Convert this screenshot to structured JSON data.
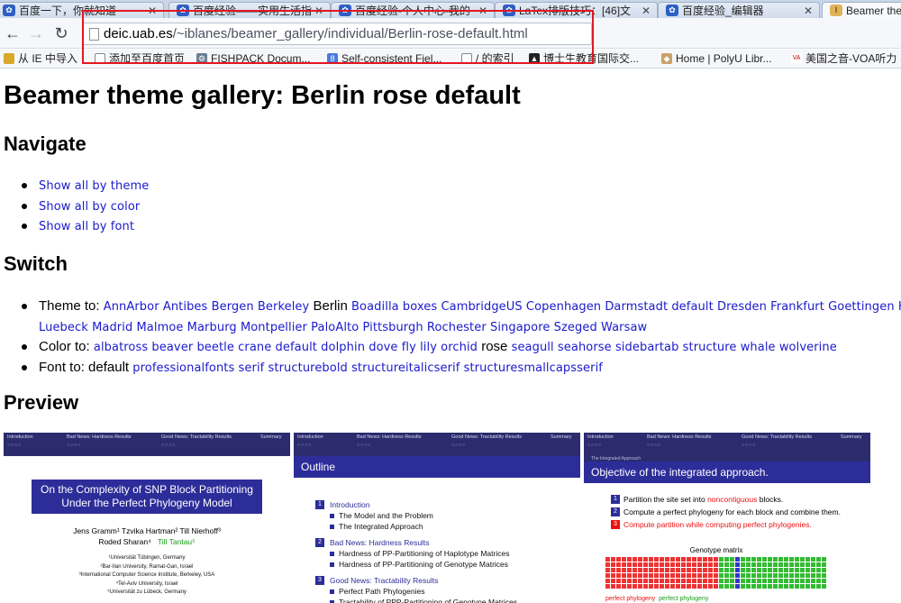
{
  "tabs": [
    {
      "label": "百度一下，你就知道",
      "active": false
    },
    {
      "label": "百度经验——实用生活指",
      "active": false
    },
    {
      "label": "百度经验-个人中心-我的",
      "active": false
    },
    {
      "label": "LaTex排版技巧：[46]文",
      "active": false
    },
    {
      "label": "百度经验_编辑器",
      "active": false
    },
    {
      "label": "Beamer the",
      "active": true
    }
  ],
  "address_bar": {
    "host": "deic.uab.es",
    "path": "/~iblanes/beamer_gallery/individual/Berlin-rose-default.html"
  },
  "bookmarks": [
    "从 IE 中导入",
    "添加至百度首页",
    "FISHPACK Docum...",
    "Self-consistent Fiel...",
    "/ 的索引",
    "博士生教育国际交...",
    "Home | PolyU Libr...",
    "美国之音-VOA听力"
  ],
  "page": {
    "title": "Beamer theme gallery: Berlin rose default",
    "navigate_heading": "Navigate",
    "navigate_links": [
      "Show all by theme",
      "Show all by color",
      "Show all by font"
    ],
    "switch_heading": "Switch",
    "theme_label": "Theme to:",
    "themes_line1": [
      "AnnArbor",
      "Antibes",
      "Bergen",
      "Berkeley"
    ],
    "theme_current": "Berlin",
    "themes_line1b": [
      "Boadilla",
      "boxes",
      "CambridgeUS",
      "Copenhagen",
      "Darmstadt",
      "default",
      "Dresden",
      "Frankfurt",
      "Goettingen",
      "Han"
    ],
    "themes_line2": [
      "Luebeck",
      "Madrid",
      "Malmoe",
      "Marburg",
      "Montpellier",
      "PaloAlto",
      "Pittsburgh",
      "Rochester",
      "Singapore",
      "Szeged",
      "Warsaw"
    ],
    "color_label": "Color to:",
    "colors_a": [
      "albatross",
      "beaver",
      "beetle",
      "crane",
      "default",
      "dolphin",
      "dove",
      "fly",
      "lily",
      "orchid"
    ],
    "color_current": "rose",
    "colors_b": [
      "seagull",
      "seahorse",
      "sidebartab",
      "structure",
      "whale",
      "wolverine"
    ],
    "font_label": "Font to:",
    "font_current": "default",
    "fonts": [
      "professionalfonts",
      "serif",
      "structurebold",
      "structureitalicserif",
      "structuresmallcapsserif"
    ],
    "preview_heading": "Preview"
  },
  "slides": {
    "nav_sections": [
      "Introduction",
      "Bad News: Hardness Results",
      "Good News: Tractability Results",
      "Summary"
    ],
    "slide1": {
      "title_line1": "On the Complexity of SNP Block Partitioning",
      "title_line2": "Under the Perfect Phylogeny Model",
      "authors_line1": "Jens Gramm¹    Tzvika Hartman²    Till Nierhoff³",
      "authors_line2a": "Roded Sharan⁴",
      "authors_line2b": "Till Tantau⁵",
      "affiliations": [
        "¹Universität Tübingen, Germany",
        "²Bar-Ilan University, Ramat-Gan, Israel",
        "³International Computer Science Institute, Berkeley, USA",
        "⁴Tel-Aviv University, Israel",
        "⁵Universität zu Lübeck, Germany"
      ]
    },
    "slide2": {
      "title": "Outline",
      "sections": [
        {
          "num": "1",
          "label": "Introduction",
          "items": [
            "The Model and the Problem",
            "The Integrated Approach"
          ]
        },
        {
          "num": "2",
          "label": "Bad News: Hardness Results",
          "items": [
            "Hardness of PP-Partitioning of Haplotype Matrices",
            "Hardness of PP-Partitioning of Genotype Matrices"
          ]
        },
        {
          "num": "3",
          "label": "Good News: Tractability Results",
          "items": [
            "Perfect Path Phylogenies",
            "Tractability of PPP-Partitioning of Genotype Matrices"
          ]
        }
      ]
    },
    "slide3": {
      "subtitle": "The Integrated Approach",
      "title": "Objective of the integrated approach.",
      "step1_pre": "Partition the site set into ",
      "step1_hl": "noncontiguous",
      "step1_post": " blocks.",
      "step2": "Compute a perfect phylogeny for each block and combine them.",
      "step3": "Compute partition while computing perfect phylogenies.",
      "matrix_caption": "Genotype matrix",
      "footer_a": "perfect phylogeny",
      "footer_b": "perfect phylogeny"
    }
  },
  "colors": {
    "link": "#1a1acd",
    "beamer_dark": "#2b2b6e",
    "beamer_title": "#2d2d9a",
    "highlight": "#e11111",
    "red_box": "#e2171f"
  }
}
